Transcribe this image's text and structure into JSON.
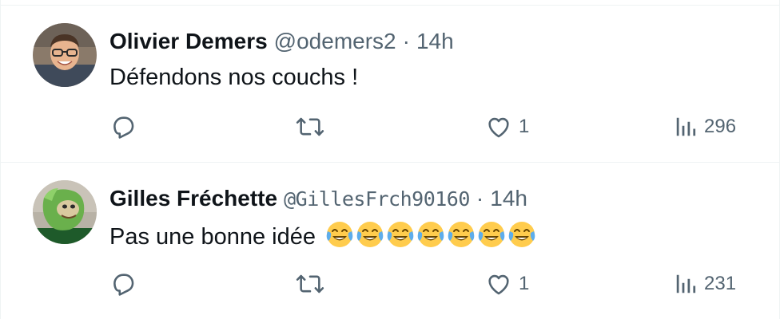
{
  "tweets": [
    {
      "author": "Olivier Demers",
      "handle": "@odemers2",
      "separator": "·",
      "time": "14h",
      "text": "Défendons nos couchs !",
      "emojis": [],
      "likes": "1",
      "views": "296"
    },
    {
      "author": "Gilles Fréchette",
      "handle": "@GillesFrch90160",
      "separator": "·",
      "time": "14h",
      "text": "Pas une bonne idée",
      "emojis": [
        "face-with-tears-of-joy",
        "face-with-tears-of-joy",
        "face-with-tears-of-joy",
        "face-with-tears-of-joy",
        "face-with-tears-of-joy",
        "face-with-tears-of-joy",
        "face-with-tears-of-joy"
      ],
      "likes": "1",
      "views": "231"
    }
  ],
  "icons": {
    "reply": "reply-icon",
    "retweet": "retweet-icon",
    "like": "heart-icon",
    "views": "views-icon"
  },
  "colors": {
    "text_primary": "#0f1419",
    "text_secondary": "#536471",
    "divider": "#eff3f4",
    "emoji_face": "#ffcc4d"
  }
}
